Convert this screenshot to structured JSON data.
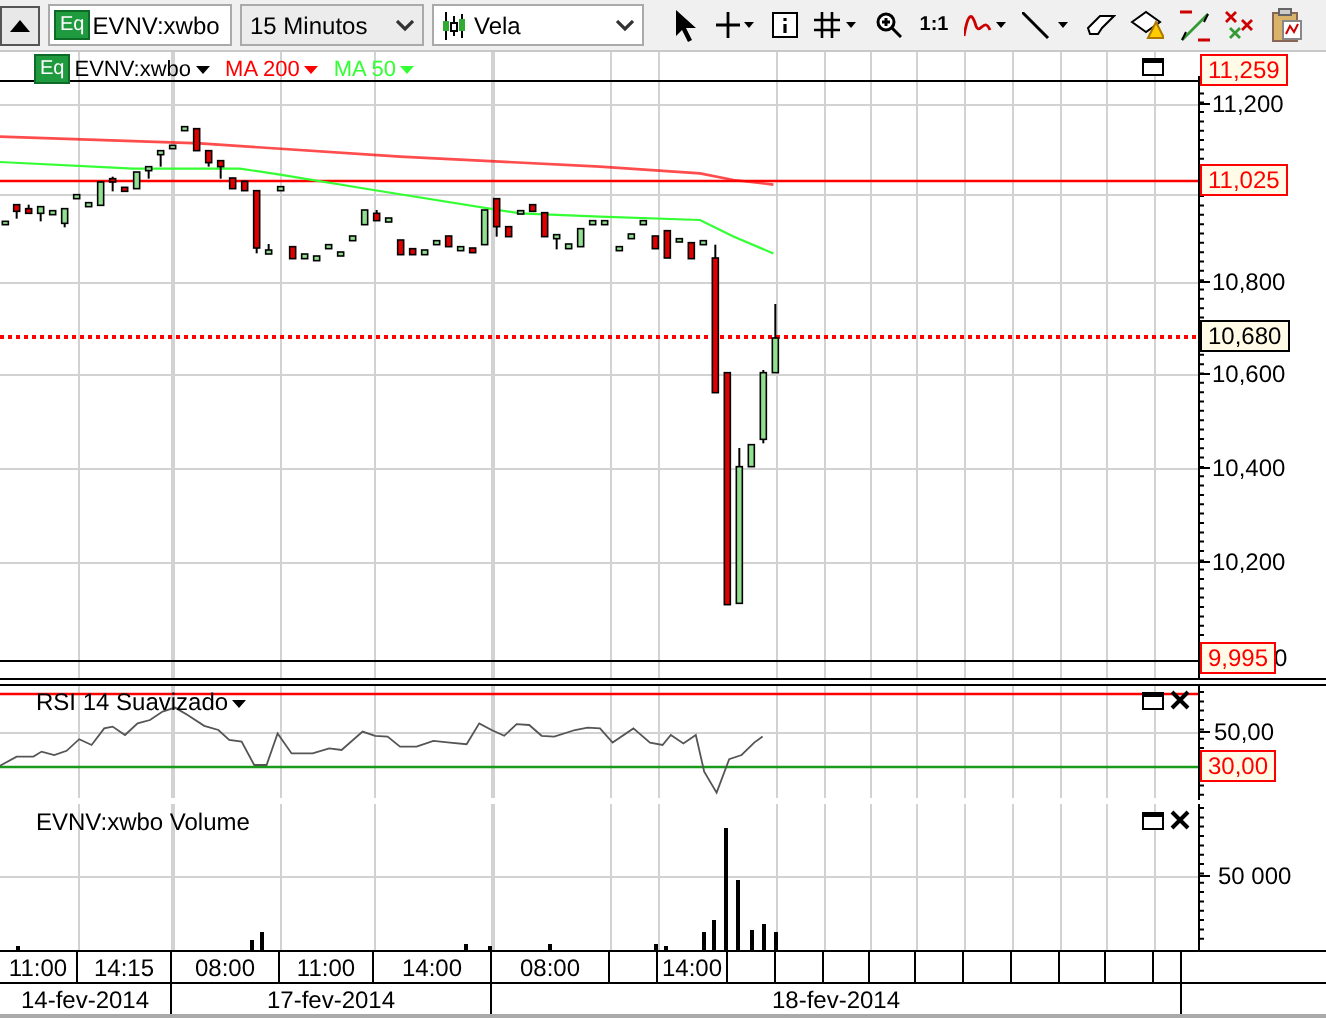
{
  "toolbar": {
    "symbol_field": {
      "badge": "Eq",
      "value": "EVNV:xwbo"
    },
    "interval_select": {
      "value": "15 Minutos"
    },
    "chart_type_select": {
      "value": "Vela"
    },
    "ratio_button": "1:1"
  },
  "price_panel": {
    "legend": [
      {
        "kind": "symbol",
        "badge": "Eq",
        "label": "EVNV:xwbo"
      },
      {
        "kind": "indicator",
        "label": "MA 200",
        "color": "#ff0000"
      },
      {
        "kind": "indicator",
        "label": "MA 50",
        "color": "#33ff33"
      }
    ],
    "axis_labels": [
      "11,200",
      "10,800",
      "10,600",
      "10,400",
      "10,200",
      "0"
    ],
    "price_tags": [
      {
        "label": "11,259",
        "kind": "alert"
      },
      {
        "label": "11,025",
        "kind": "alert"
      },
      {
        "label": "10,680",
        "kind": "last"
      },
      {
        "label": "9,995",
        "kind": "alert"
      }
    ]
  },
  "rsi_panel": {
    "title": "RSI 14 Suavizado",
    "axis_labels": [
      "50,00"
    ],
    "price_tags": [
      {
        "label": "30,00",
        "kind": "alert"
      }
    ]
  },
  "volume_panel": {
    "title": "EVNV:xwbo Volume",
    "axis_labels": [
      "50 000"
    ]
  },
  "time_axis": {
    "times": [
      "11:00",
      "14:15",
      "08:00",
      "11:00",
      "14:00",
      "08:00",
      "14:00"
    ],
    "dates": [
      "14-fev-2014",
      "17-fev-2014",
      "18-fev-2014"
    ]
  }
}
